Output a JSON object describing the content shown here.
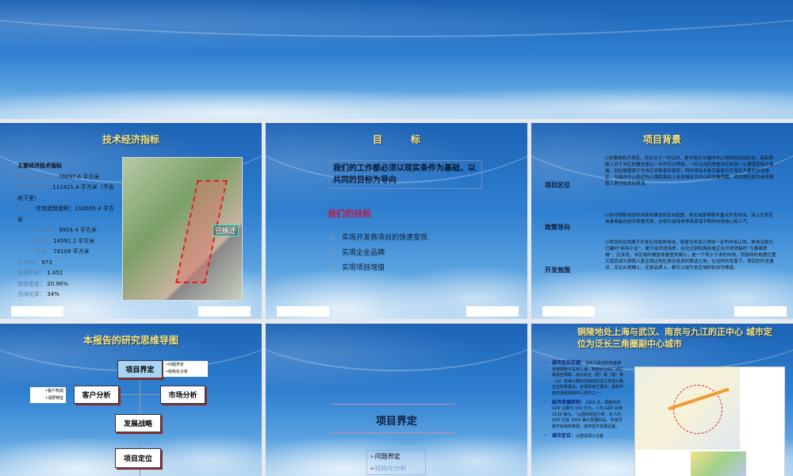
{
  "slide1": {
    "title": "技术经济指标",
    "heading": "主要经济技术指标",
    "rows": [
      {
        "k": "规划用地面积：",
        "v": "76697.6 平方米"
      },
      {
        "k": "总建筑面积：",
        "v": "111421.4 平方米（不含地下室）"
      },
      {
        "k": "其中：",
        "v": "住宅建筑面积：102605.4 平方米"
      },
      {
        "k": "小高层：",
        "v": "9904.4 平方米"
      },
      {
        "k": "高层：",
        "v": "14591.2 平方米"
      },
      {
        "k": "多层：",
        "v": "78109 平方米"
      },
      {
        "k": "总户数：",
        "v": "973"
      },
      {
        "k": "总容积率：",
        "v": "1.452"
      },
      {
        "k": "建筑密度：",
        "v": "20.96%"
      },
      {
        "k": "总绿化率：",
        "v": "34%"
      }
    ],
    "map_label": "已拆迁"
  },
  "slide2": {
    "title": "目　　　标",
    "statement": "我们的工作都必须以现实条件为基础，以共同的目标为导向",
    "subtitle": "我们的目标",
    "items": [
      "实现开发商项目的快速变现",
      "实现企业品牌",
      "实现项目增值"
    ]
  },
  "slide3": {
    "title": "项目背景",
    "sections": [
      {
        "label": "项目区位",
        "text": "☑本案地处开发区，但又位于一环以内，是开发区与城市中心地块较近的区块，具有铜陵人对于市区的概念是以一环作为分界线，一环以内仍然是市区的这一心理感受较为普遍，因此楼盘易于为市区消费者所接受，同时项目本身又能吸引开发区大量的白领进驻，与城市中心较近的心理距离加上未来城市次中心的发展预期，项目理应成为未来铜陵人居住投资的首选。"
      },
      {
        "label": "政策导向",
        "text": "☑依托铜陵市政府对城市建设的宏伟蓝图，本区域是铜陵市重点开发地块，加上开发区自身具备的经济发展优势，必将为该地块带来源源不断的市场信心和人气。"
      },
      {
        "label": "开发氛围",
        "text": "☑项目所在地属于开发区较成熟地块，就居住来说已得到一定的市场认同。地块北侧为已建的“新苑小区”，属于经济适用房，往北过铜抚路则是正在开发销售的“万泰翡翠城”，应该说，本区域的楼盘体量显然偏小，是一个供小于求的市场，而独特的地理位置又使其成为铜陵人甚至周边地区居住投资的首选之地，在这样的背景下，项目的开发建设，无论从规模上，还是品质上，都可以成为本区域的标志性楼盘。"
      }
    ]
  },
  "slide4": {
    "title": "本报告的研究思维导图",
    "nodes": [
      "项目界定",
      "客户分析",
      "市场分析",
      "发展战略",
      "项目定位"
    ],
    "notes_right": [
      "•问题界定",
      "•结构化分析"
    ],
    "notes_left": [
      "•客户构成",
      "•消费特征"
    ]
  },
  "slide5": {
    "title": "项目界定",
    "items": [
      "问题界定",
      "结构化分析"
    ]
  },
  "slide6": {
    "title": "铜陵地处上海与武汉、南京与九江的正中心 城市定位为泛长三角圈副中心城市",
    "bullets": [
      {
        "head": "城市区位优越：",
        "text": "沿长江走向的快速通道使铜陵与东到上海、西到武汉的广阔区域紧密相联。南北的合（肥）铜（陵）黄（山）高速公路和东西向的沿江高速公路正在积极建设，合铜高速已建成，是皖中南交通枢纽和中心城市之一。"
      },
      {
        "head": "经济发展较快：",
        "text": "2005 年，铜陵市的 GDP 总量为 182 亿元，人均 GDP 达到 3130 美元。“从国际经验分析，在人均 GDP 达到 3000 美元发展阶段，环境问题开始得到重视，城市经济发展迅猛；"
      },
      {
        "head": "城市定位：",
        "text": "以建设铜工业基"
      }
    ]
  }
}
